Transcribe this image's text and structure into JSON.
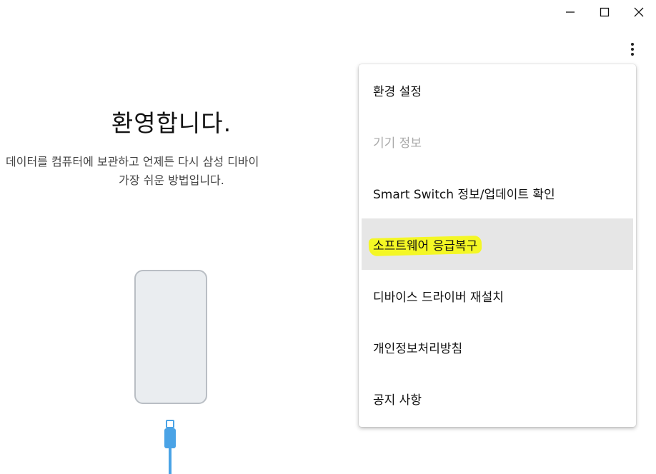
{
  "window_controls": {
    "minimize": "minimize-icon",
    "maximize": "maximize-icon",
    "close": "close-icon"
  },
  "main": {
    "title": "환영합니다.",
    "description_line1": "데이터를 컴퓨터에 보관하고 언제든 다시 삼성 디바이",
    "description_line2": "가장 쉬운 방법입니다."
  },
  "menu": {
    "items": [
      {
        "label": "환경 설정",
        "enabled": true
      },
      {
        "label": "기기 정보",
        "enabled": false
      },
      {
        "label": "Smart Switch 정보/업데이트 확인",
        "enabled": true
      },
      {
        "label": "소프트웨어 응급복구",
        "enabled": true,
        "highlighted": true
      },
      {
        "label": "디바이스 드라이버 재설치",
        "enabled": true
      },
      {
        "label": "개인정보처리방침",
        "enabled": true
      },
      {
        "label": "공지 사항",
        "enabled": true
      }
    ]
  },
  "colors": {
    "cable": "#4aa3e6",
    "highlight": "#f4f725",
    "hover": "#e6e6e6",
    "disabled_text": "#a9a9a9"
  }
}
